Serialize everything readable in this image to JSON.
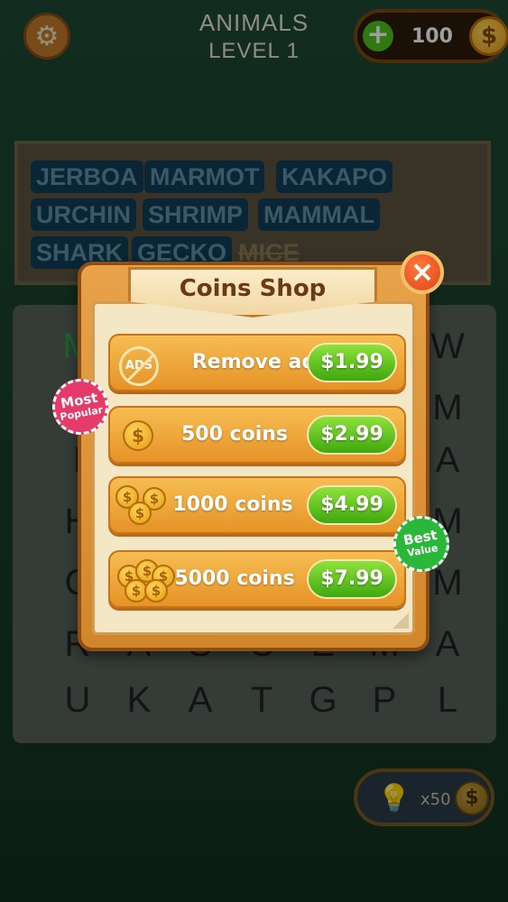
{
  "header": {
    "category": "ANIMALS",
    "level": "LEVEL 1",
    "coins": "100",
    "plus_icon": "+",
    "coin_symbol": "$",
    "settings_icon": "gear-icon"
  },
  "words": [
    {
      "text": "JERBOA",
      "found": false
    },
    {
      "text": "MARMOT",
      "found": false
    },
    {
      "text": "KAKAPO",
      "found": false
    },
    {
      "text": "URCHIN",
      "found": false
    },
    {
      "text": "SHRIMP",
      "found": false
    },
    {
      "text": "MAMMAL",
      "found": false
    },
    {
      "text": "SHARK",
      "found": false
    },
    {
      "text": "GECKO",
      "found": false
    },
    {
      "text": "MICE",
      "found": true
    }
  ],
  "grid_visible_letters": {
    "row_left_top": [
      "M"
    ],
    "col_right": [
      "W",
      "M",
      "A",
      "M",
      "M"
    ],
    "col_left": [
      "I",
      "H",
      "C"
    ],
    "row7": [
      "R",
      "A",
      "S",
      "C",
      "E",
      "M",
      "A"
    ],
    "row8": [
      "U",
      "K",
      "A",
      "T",
      "G",
      "P",
      "L"
    ]
  },
  "hint": {
    "cost": "x50",
    "coin_symbol": "$"
  },
  "shop": {
    "title": "Coins Shop",
    "close_icon": "×",
    "ads_icon_text": "ADS",
    "coin_symbol": "$",
    "items": [
      {
        "label": "Remove ads",
        "price": "$1.99",
        "icon": "no-ads-icon"
      },
      {
        "label": "500 coins",
        "price": "$2.99",
        "icon": "coin-icon"
      },
      {
        "label": "1000 coins",
        "price": "$4.99",
        "icon": "coin-stack-icon"
      },
      {
        "label": "5000 coins",
        "price": "$7.99",
        "icon": "coin-pile-icon"
      }
    ],
    "badge_popular": {
      "line1": "Most",
      "line2": "Popular",
      "color": "#e63a6a"
    },
    "badge_value": {
      "line1": "Best",
      "line2": "Value",
      "color": "#2bb83a"
    }
  },
  "colors": {
    "price_green": "#4cc21e",
    "item_orange": "#e69326",
    "close_red": "#e1421a"
  }
}
